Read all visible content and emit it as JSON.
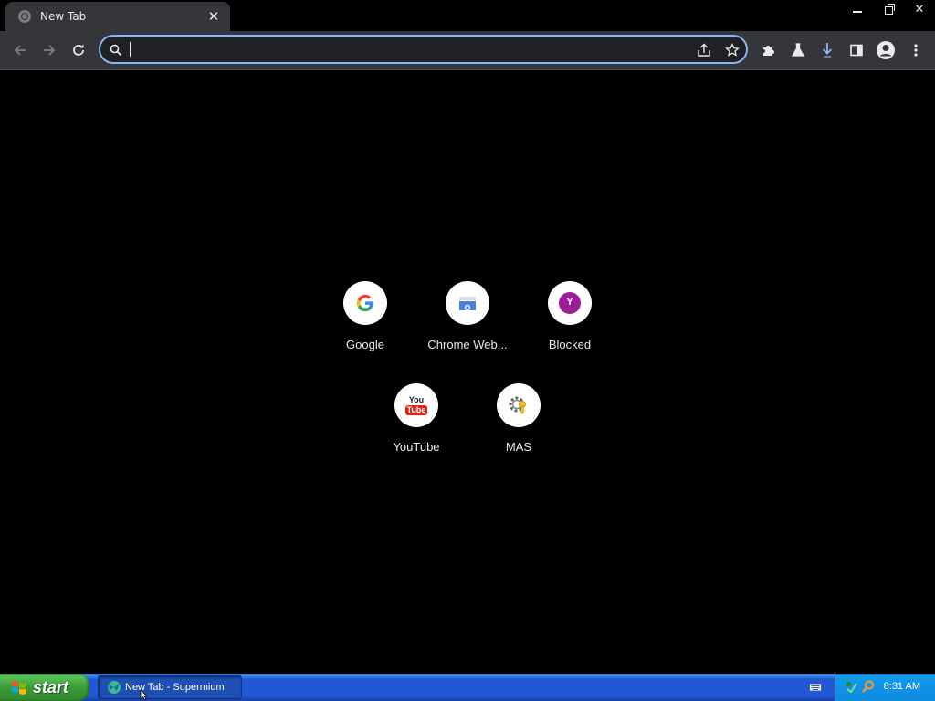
{
  "browser": {
    "tab": {
      "title": "New Tab",
      "close_glyph": "✕"
    },
    "window_controls": {
      "close_glyph": "✕"
    },
    "omnibox": {
      "value": "",
      "placeholder": ""
    }
  },
  "shortcuts": [
    {
      "label": "Google",
      "icon": "google-g-icon"
    },
    {
      "label": "Chrome Web...",
      "icon": "chrome-web-store-icon"
    },
    {
      "label": "Blocked",
      "icon": "yahoo-y-icon",
      "icon_letter": "Y"
    },
    {
      "label": "YouTube",
      "icon": "youtube-logo-icon",
      "icon_text_top": "You",
      "icon_text_bottom": "Tube"
    },
    {
      "label": "MAS",
      "icon": "gear-key-icon"
    }
  ],
  "taskbar": {
    "start_label": "start",
    "task_label": "New Tab - Supermium",
    "clock": "8:31 AM"
  },
  "colors": {
    "omnibox_focus": "#8ab4f8",
    "toolbar": "#35363a",
    "page_bg": "#000000",
    "download_accent": "#8ab4f8",
    "yahoo_purple": "#9c1d97",
    "youtube_red": "#e62117"
  }
}
